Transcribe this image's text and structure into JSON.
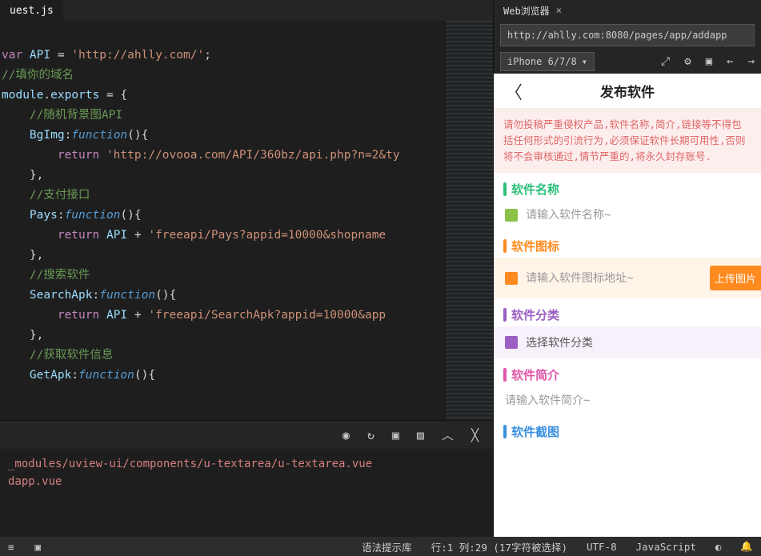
{
  "editor": {
    "tab": "uest.js",
    "consoleLines": [
      "_modules/uview-ui/components/u-textarea/u-textarea.vue",
      "dapp.vue"
    ]
  },
  "code": {
    "l1a": "var",
    "l1b": " API ",
    "l1c": "=",
    "l1d": " 'http://ahlly.com/'",
    "l1e": ";",
    "l2": "//填你的域名",
    "l3a": "module",
    "l3b": ".",
    "l3c": "exports",
    "l3d": " = {",
    "l4": "    //随机背景图API",
    "l5a": "    BgImg",
    "l5b": ":",
    "l5c": "function",
    "l5d": "(){",
    "l6a": "        return",
    "l6b": " 'http://ovooa.com/API/360bz/api.php?n=2&ty",
    "l7": "    },",
    "l8": "    //支付接口",
    "l9a": "    Pays",
    "l9b": ":",
    "l9c": "function",
    "l9d": "(){",
    "l10a": "        return",
    "l10b": " API ",
    "l10c": "+",
    "l10d": " 'freeapi/Pays?appid=10000&shopname",
    "l11": "    },",
    "l12": "    //搜索软件",
    "l13a": "    SearchApk",
    "l13b": ":",
    "l13c": "function",
    "l13d": "(){",
    "l14a": "        return",
    "l14b": " API ",
    "l14c": "+",
    "l14d": " 'freeapi/SearchApk?appid=10000&app",
    "l15": "    },",
    "l16": "    //获取软件信息",
    "l17a": "    GetApk",
    "l17b": ":",
    "l17c": "function",
    "l17d": "(){"
  },
  "browser": {
    "tab": "Web浏览器",
    "url": "http://ahlly.com:8080/pages/app/addapp",
    "device": "iPhone 6/7/8"
  },
  "preview": {
    "title": "发布软件",
    "warning": "请勿投稿严重侵权产品,软件名称,简介,链接等不得包括任何形式的引流行为,必须保证软件长期可用性,否则将不会审核通过,情节严重的,将永久封存账号.",
    "sec1": "软件名称",
    "ph1": "请输入软件名称~",
    "sec2": "软件图标",
    "ph2": "请输入软件图标地址~",
    "upload": "上传图片",
    "sec3": "软件分类",
    "ph3": "选择软件分类",
    "sec4": "软件简介",
    "ph4": "请输入软件简介~",
    "sec5": "软件截图",
    "colors": {
      "green": "#2bbf7a",
      "orange": "#ff8a1f",
      "purple": "#9b5fc4",
      "pink": "#e254a7",
      "blue": "#3a8fe0"
    }
  },
  "status": {
    "hint": "语法提示库",
    "pos": "行:1 列:29 (17字符被选择)",
    "encoding": "UTF-8",
    "lang": "JavaScript"
  }
}
